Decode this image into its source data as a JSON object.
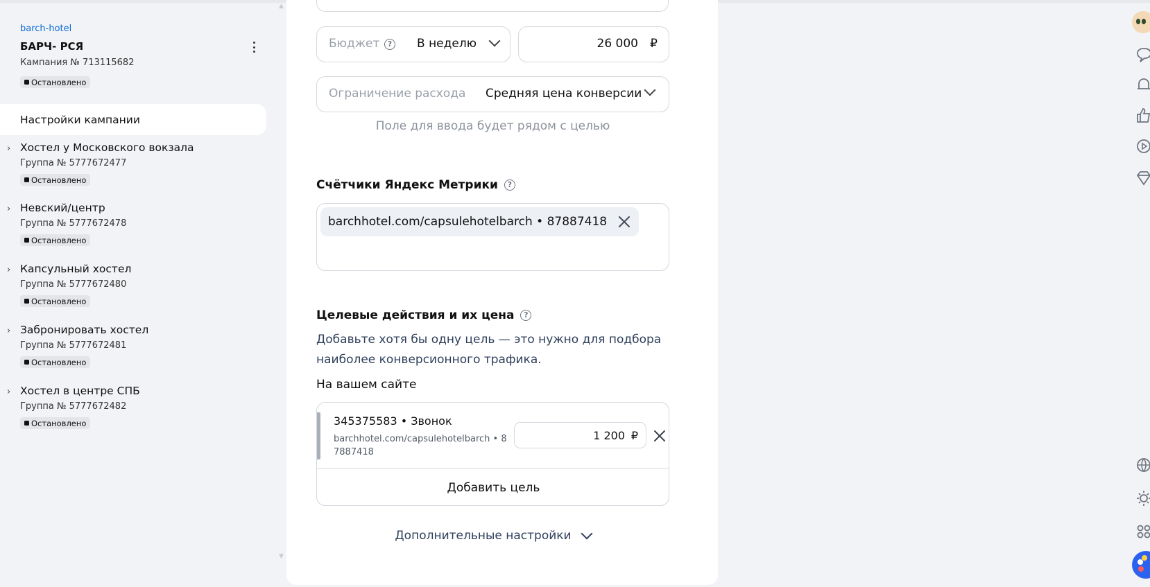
{
  "campaign": {
    "link": "barch-hotel",
    "title": "БАРЧ- РСЯ",
    "number": "Кампания № 713115682",
    "status": "Остановлено"
  },
  "sidebar": {
    "settings_label": "Настройки кампании",
    "groups": [
      {
        "name": "Хостел у Московского вокзала",
        "number": "Группа № 5777672477",
        "status": "Остановлено"
      },
      {
        "name": "Невский/центр",
        "number": "Группа № 5777672478",
        "status": "Остановлено"
      },
      {
        "name": "Капсульный хостел",
        "number": "Группа № 5777672480",
        "status": "Остановлено"
      },
      {
        "name": "Забронировать хостел",
        "number": "Группа № 5777672481",
        "status": "Остановлено"
      },
      {
        "name": "Хостел в центре СПБ",
        "number": "Группа № 5777672482",
        "status": "Остановлено"
      }
    ]
  },
  "budget": {
    "label": "Бюджет",
    "period": "В неделю",
    "amount": "26 000",
    "currency": "₽"
  },
  "limit": {
    "label": "Ограничение расхода",
    "value": "Средняя цена конверсии",
    "hint": "Поле для ввода будет рядом с целью"
  },
  "counters": {
    "title": "Счётчики Яндекс Метрики",
    "chip": "barchhotel.com/capsulehotelbarch • 87887418"
  },
  "goals": {
    "title": "Целевые действия и их цена",
    "description": "Добавьте хотя бы одну цель — это нужно для подбора наиболее конверсионного трафика.",
    "onsite_label": "На вашем сайте",
    "items": [
      {
        "title": "345375583 • Звонок",
        "subtitle": "barchhotel.com/capsulehotelbarch • 87887418",
        "price": "1 200",
        "currency": "₽"
      }
    ],
    "add_label": "Добавить цель"
  },
  "more_settings_label": "Дополнительные настройки",
  "icons": [
    "help-circle-icon",
    "chevron-down-icon",
    "close-icon",
    "kebab-menu-icon",
    "chat-icon",
    "bell-icon",
    "like-icon",
    "play-icon",
    "diamond-icon",
    "globe-icon",
    "sun-icon",
    "apps-icon"
  ],
  "colors": {
    "link": "#0a6bd8",
    "panel": "#ffffff",
    "background": "#f2f3f6",
    "accent_ball": "#2b63f0"
  }
}
